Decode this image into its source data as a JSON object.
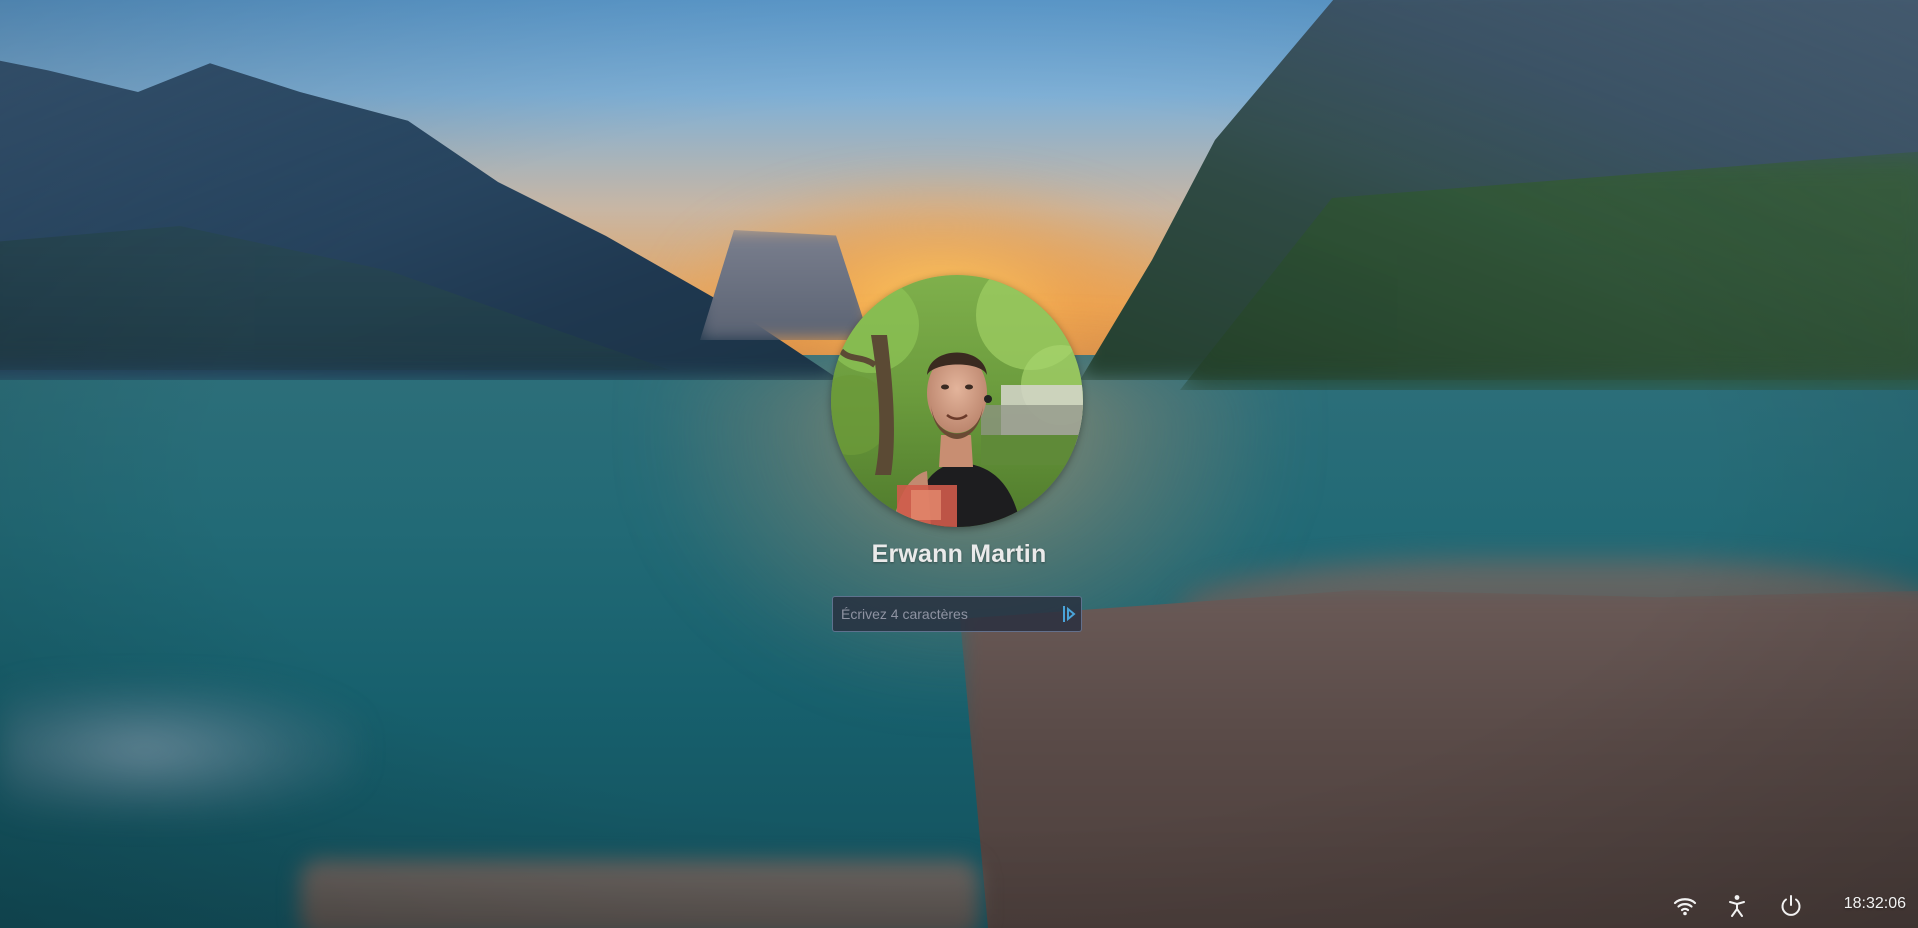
{
  "login": {
    "user_name": "Erwann Martin",
    "password_placeholder": "Écrivez 4 caractères"
  },
  "tray": {
    "wifi_icon": "wifi-icon",
    "accessibility_icon": "accessibility-icon",
    "power_icon": "power-icon",
    "clock": "18:32:06"
  },
  "colors": {
    "input_border": "#8ca0c8",
    "input_background": "#282e3e",
    "text": "#eaeaea",
    "caps_indicator": "#4aa3d8"
  }
}
